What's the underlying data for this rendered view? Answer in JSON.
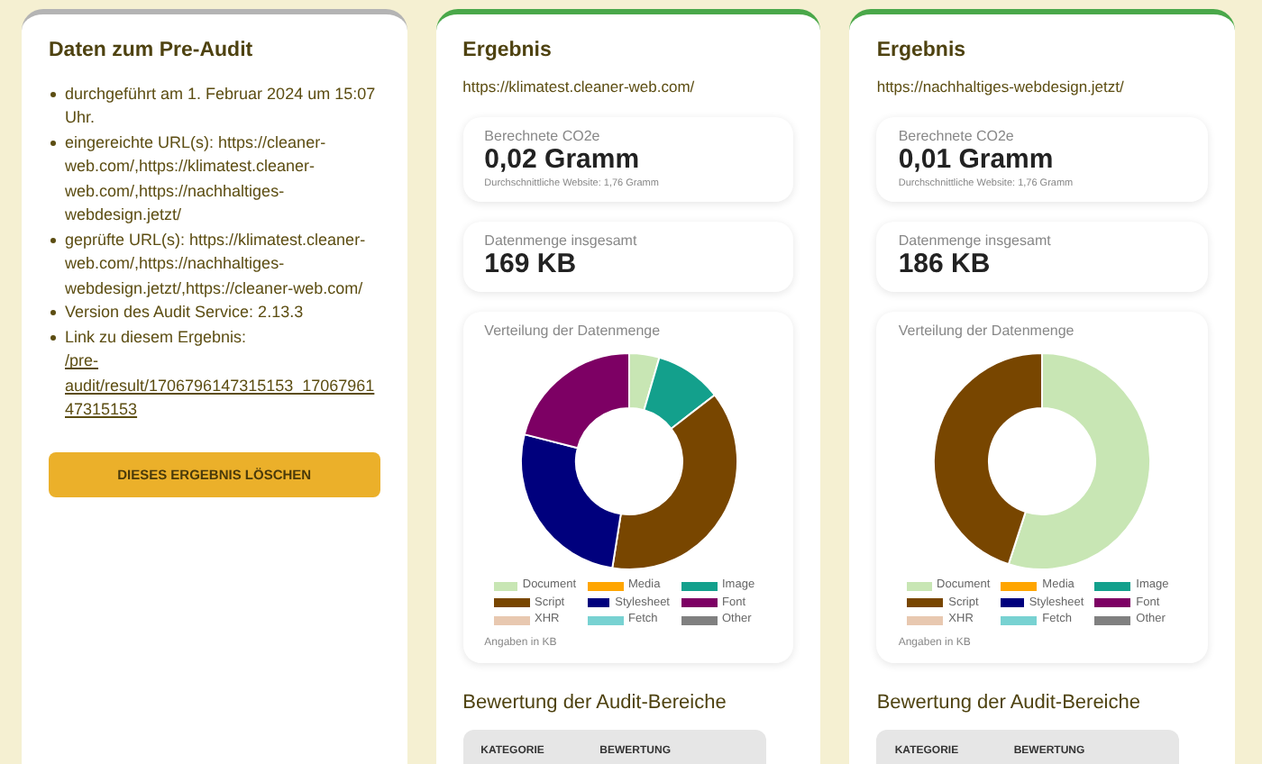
{
  "pre_audit": {
    "title": "Daten zum Pre-Audit",
    "items": [
      {
        "kind": "text",
        "text": "durchgeführt am 1. Februar 2024 um 15:07 Uhr."
      },
      {
        "kind": "text",
        "text": "eingereichte URL(s): https://cleaner-web.com/,https://klimatest.cleaner-web.com/,https://nachhaltiges-webdesign.jetzt/"
      },
      {
        "kind": "text",
        "text": "geprüfte URL(s): https://klimatest.cleaner-web.com/,https://nachhaltiges-webdesign.jetzt/,https://cleaner-web.com/"
      },
      {
        "kind": "text",
        "text": "Version des Audit Service: 2.13.3"
      },
      {
        "kind": "link",
        "text": "Link zu diesem Ergebnis:",
        "link": "/pre-audit/result/1706796147315153_1706796147315153"
      }
    ],
    "button": "DIESES ERGEBNIS LÖSCHEN"
  },
  "results": [
    {
      "title": "Ergebnis",
      "url": "https://klimatest.cleaner-web.com/",
      "co2": {
        "label": "Berechnete CO2e",
        "value": "0,02 Gramm",
        "note": "Durchschnittliche Website: 1,76 Gramm"
      },
      "data": {
        "label": "Datenmenge insgesamt",
        "value": "169 KB"
      },
      "chart": {
        "title": "Verteilung der Datenmenge",
        "note": "Angaben in KB",
        "legend": [
          {
            "label": "Document",
            "color": "#c8e6b4"
          },
          {
            "label": "Media",
            "color": "#ffa500"
          },
          {
            "label": "Image",
            "color": "#13a08c"
          },
          {
            "label": "Script",
            "color": "#784600"
          },
          {
            "label": "Stylesheet",
            "color": "#00007d"
          },
          {
            "label": "Font",
            "color": "#7d0064"
          },
          {
            "label": "XHR",
            "color": "#e8c8b0"
          },
          {
            "label": "Fetch",
            "color": "#78d2d2"
          },
          {
            "label": "Other",
            "color": "#808080"
          }
        ]
      },
      "ratings": {
        "title": "Bewertung der Audit-Bereiche",
        "columns": [
          "KATEGORIE",
          "BEWERTUNG"
        ]
      }
    },
    {
      "title": "Ergebnis",
      "url": "https://nachhaltiges-webdesign.jetzt/",
      "co2": {
        "label": "Berechnete CO2e",
        "value": "0,01 Gramm",
        "note": "Durchschnittliche Website: 1,76 Gramm"
      },
      "data": {
        "label": "Datenmenge insgesamt",
        "value": "186 KB"
      },
      "chart": {
        "title": "Verteilung der Datenmenge",
        "note": "Angaben in KB",
        "legend": [
          {
            "label": "Document",
            "color": "#c8e6b4"
          },
          {
            "label": "Media",
            "color": "#ffa500"
          },
          {
            "label": "Image",
            "color": "#13a08c"
          },
          {
            "label": "Script",
            "color": "#784600"
          },
          {
            "label": "Stylesheet",
            "color": "#00007d"
          },
          {
            "label": "Font",
            "color": "#7d0064"
          },
          {
            "label": "XHR",
            "color": "#e8c8b0"
          },
          {
            "label": "Fetch",
            "color": "#78d2d2"
          },
          {
            "label": "Other",
            "color": "#808080"
          }
        ]
      },
      "ratings": {
        "title": "Bewertung der Audit-Bereiche",
        "columns": [
          "KATEGORIE",
          "BEWERTUNG"
        ]
      }
    }
  ]
}
